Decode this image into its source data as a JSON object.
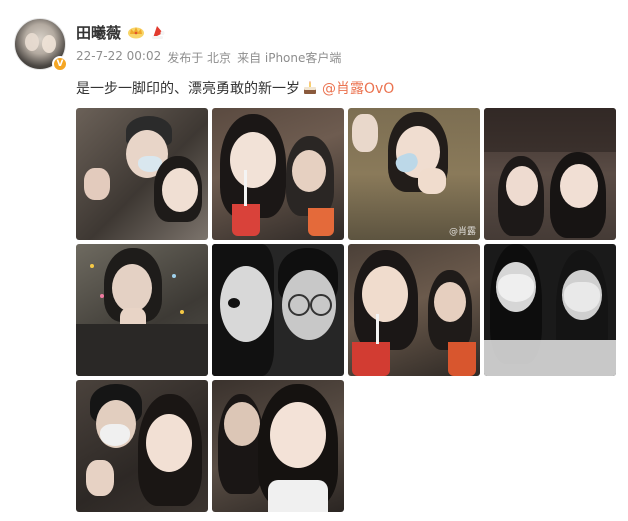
{
  "user": {
    "name": "田曦薇",
    "verified_badge": "V"
  },
  "meta": {
    "date": "22-7-22 00:02",
    "location": "发布于 北京",
    "source": "来自 iPhone客户端"
  },
  "post": {
    "text": "是一步一脚印的、漂亮勇敢的新一岁",
    "mention": "@肖露OvO"
  },
  "photos": [
    {
      "alt": "photo-1"
    },
    {
      "alt": "photo-2"
    },
    {
      "alt": "photo-3",
      "watermark": "@肖露"
    },
    {
      "alt": "photo-4"
    },
    {
      "alt": "photo-5"
    },
    {
      "alt": "photo-6"
    },
    {
      "alt": "photo-7"
    },
    {
      "alt": "photo-8"
    },
    {
      "alt": "photo-9"
    },
    {
      "alt": "photo-10"
    }
  ],
  "icons": {
    "crown": "crown-icon",
    "hat": "santa-hat-icon",
    "cake": "cake-icon"
  },
  "colors": {
    "mention": "#eb7350",
    "meta": "#8e8e8e",
    "text": "#333333"
  }
}
